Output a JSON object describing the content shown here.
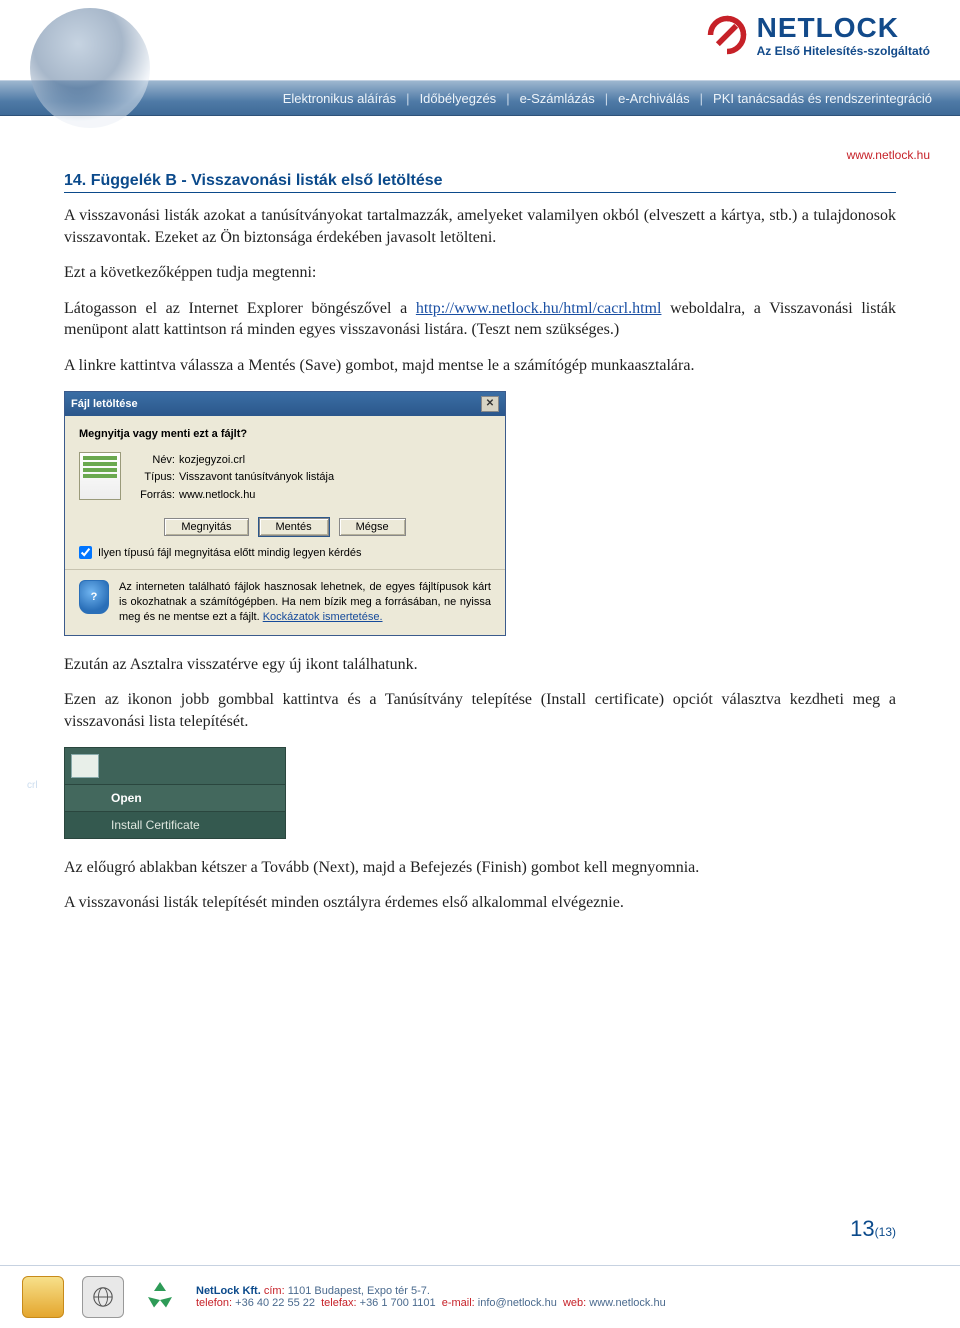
{
  "brand": {
    "name": "NETLOCK",
    "tagline": "Az Első Hitelesítés-szolgáltató",
    "url_top": "www.netlock.hu"
  },
  "nav": {
    "items": [
      "Elektronikus aláírás",
      "Időbélyegzés",
      "e-Számlázás",
      "e-Archiválás",
      "PKI tanácsadás és rendszerintegráció"
    ]
  },
  "section": {
    "number": "14.",
    "title": "Függelék B - Visszavonási listák első letöltése"
  },
  "body": {
    "p1": "A visszavonási listák azokat a tanúsítványokat tartalmazzák, amelyeket valamilyen okból (elveszett a kártya, stb.) a tulajdonosok visszavontak. Ezeket az Ön biztonsága érdekében javasolt letölteni.",
    "p2": "Ezt a következőképpen tudja megtenni:",
    "p3a": "Látogasson el az Internet Explorer böngészővel a ",
    "link": "http://www.netlock.hu/html/cacrl.html",
    "p3b": " weboldalra, a Visszavonási listák menüpont alatt kattintson rá minden egyes visszavonási listára. (Teszt nem szükséges.)",
    "p4": "A linkre kattintva válassza a Mentés (Save) gombot, majd mentse le a számítógép munkaasztalára.",
    "p5": "Ezután az Asztalra visszatérve egy új ikont találhatunk.",
    "p6": "Ezen az ikonon jobb gombbal kattintva és a Tanúsítvány telepítése (Install certificate) opciót választva kezdheti meg a visszavonási lista telepítését.",
    "p7": "Az előugró ablakban kétszer a Tovább (Next), majd a Befejezés (Finish) gombot kell megnyomnia.",
    "p8": "A visszavonási listák telepítését minden osztályra érdemes első alkalommal elvégeznie."
  },
  "dialog": {
    "title": "Fájl letöltése",
    "question": "Megnyitja vagy menti ezt a fájlt?",
    "name_label": "Név:",
    "name_value": "kozjegyzoi.crl",
    "type_label": "Típus:",
    "type_value": "Visszavont tanúsítványok listája",
    "source_label": "Forrás:",
    "source_value": "www.netlock.hu",
    "btn_open": "Megnyitás",
    "btn_save": "Mentés",
    "btn_cancel": "Mégse",
    "checkbox": "Ilyen típusú fájl megnyitása előtt mindig legyen kérdés",
    "warn1": "Az interneten található fájlok hasznosak lehetnek, de egyes fájltípusok kárt is okozhatnak a számítógépben. Ha nem bízik meg a forrásában, ne nyissa meg és ne mentse ezt a fájlt. ",
    "warn_link": "Kockázatok ismertetése."
  },
  "context_menu": {
    "ext": "crl",
    "open": "Open",
    "install": "Install Certificate"
  },
  "footer": {
    "company": "NetLock Kft.",
    "addr_label": "cím:",
    "addr": "1101 Budapest, Expo tér 5-7.",
    "tel_label": "telefon:",
    "tel": "+36 40 22 55 22",
    "fax_label": "telefax:",
    "fax": "+36 1 700 1101",
    "mail_label": "e-mail:",
    "mail": "info@netlock.hu",
    "web_label": "web:",
    "web": "www.netlock.hu"
  },
  "page": {
    "current": "13",
    "total": "(13)"
  }
}
